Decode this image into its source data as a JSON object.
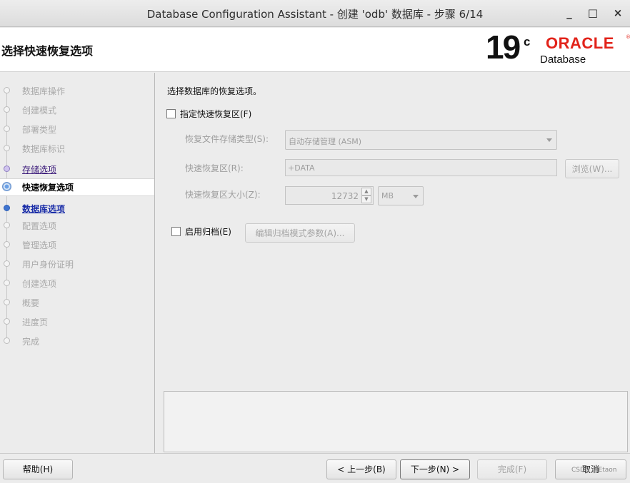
{
  "window": {
    "title": "Database Configuration Assistant - 创建 'odb' 数据库 - 步骤 6/14",
    "minimize": "_",
    "maximize": "□",
    "close": "×"
  },
  "header": {
    "page_title": "选择快速恢复选项",
    "logo": {
      "version": "19",
      "version_sup": "c",
      "brand": "ORACLE",
      "product": "Database",
      "brand_color": "#e2231a"
    }
  },
  "steps": [
    {
      "label": "数据库操作",
      "state": "disabled"
    },
    {
      "label": "创建模式",
      "state": "disabled"
    },
    {
      "label": "部署类型",
      "state": "disabled"
    },
    {
      "label": "数据库标识",
      "state": "disabled"
    },
    {
      "label": "存储选项",
      "state": "link"
    },
    {
      "label": "快速恢复选项",
      "state": "active"
    },
    {
      "label": "数据库选项",
      "state": "next"
    },
    {
      "label": "配置选项",
      "state": "disabled"
    },
    {
      "label": "管理选项",
      "state": "disabled"
    },
    {
      "label": "用户身份证明",
      "state": "disabled"
    },
    {
      "label": "创建选项",
      "state": "disabled"
    },
    {
      "label": "概要",
      "state": "disabled"
    },
    {
      "label": "进度页",
      "state": "disabled"
    },
    {
      "label": "完成",
      "state": "disabled"
    }
  ],
  "main": {
    "prompt": "选择数据库的恢复选项。",
    "fra_checkbox": {
      "label": "指定快速恢复区(F)",
      "checked": false
    },
    "storage_type": {
      "label": "恢复文件存储类型(S):",
      "value": "自动存储管理 (ASM)"
    },
    "fra_location": {
      "label": "快速恢复区(R):",
      "value": "+DATA",
      "browse": "浏览(W)..."
    },
    "fra_size": {
      "label": "快速恢复区大小(Z):",
      "value": "12732",
      "unit": "MB"
    },
    "archive_checkbox": {
      "label": "启用归档(E)",
      "checked": false
    },
    "archive_params_button": "编辑归档模式参数(A)..."
  },
  "buttons": {
    "help": "帮助(H)",
    "back": "< 上一步(B)",
    "next": "下一步(N) >",
    "finish": "完成(F)",
    "cancel": "取消"
  },
  "watermark": "CSDN @Etaon"
}
